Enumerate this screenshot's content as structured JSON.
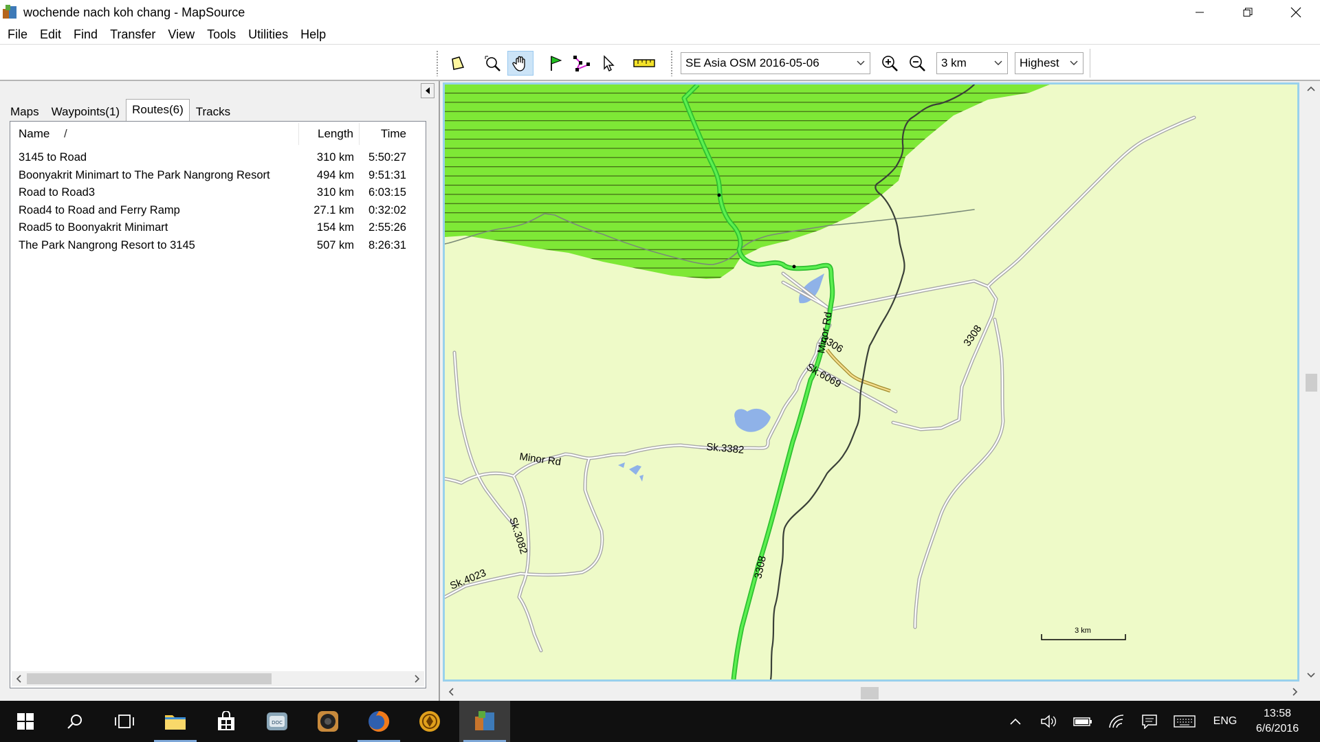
{
  "window": {
    "title": "wochende nach koh chang - MapSource"
  },
  "menu": [
    "File",
    "Edit",
    "Find",
    "Transfer",
    "View",
    "Tools",
    "Utilities",
    "Help"
  ],
  "toolbar": {
    "map_product": "SE Asia OSM 2016-05-06",
    "zoom_scale": "3 km",
    "detail_level": "Highest"
  },
  "tabs": [
    {
      "label": "Maps"
    },
    {
      "label": "Waypoints(1)"
    },
    {
      "label": "Routes(6)"
    },
    {
      "label": "Tracks"
    }
  ],
  "routes": {
    "columns": {
      "name": "Name",
      "sort": "/",
      "length": "Length",
      "time": "Time"
    },
    "rows": [
      {
        "name": "3145 to Road",
        "length": "310 km",
        "time": "5:50:27"
      },
      {
        "name": "Boonyakrit Minimart to The Park Nangrong Resort",
        "length": "494 km",
        "time": "9:51:31"
      },
      {
        "name": "Road to Road3",
        "length": "310 km",
        "time": "6:03:15"
      },
      {
        "name": "Road4 to Road and Ferry Ramp",
        "length": "27.1 km",
        "time": "0:32:02"
      },
      {
        "name": "Road5 to Boonyakrit Minimart",
        "length": "154 km",
        "time": "2:55:26"
      },
      {
        "name": "The Park Nangrong Resort to 3145",
        "length": "507 km",
        "time": "8:26:31"
      }
    ]
  },
  "map": {
    "labels": {
      "r3306": "3306",
      "sk6069": "Sk.6069",
      "minor_rd_vertical": "Minor Rd",
      "r3308_top": "3308",
      "r3308_bottom": "3308",
      "sk3382": "Sk.3382",
      "minor_rd": "Minor Rd",
      "sk3082": "Sk.3082",
      "sk4023": "Sk.4023"
    },
    "scale_label": "3 km",
    "colors": {
      "land": "#eefac8",
      "forest": "#7ee836",
      "route": "#3ee33a",
      "water": "#8fb2e8",
      "road": "#c8c8c8"
    }
  },
  "taskbar": {
    "language": "ENG",
    "time": "13:58",
    "date": "6/6/2016"
  }
}
